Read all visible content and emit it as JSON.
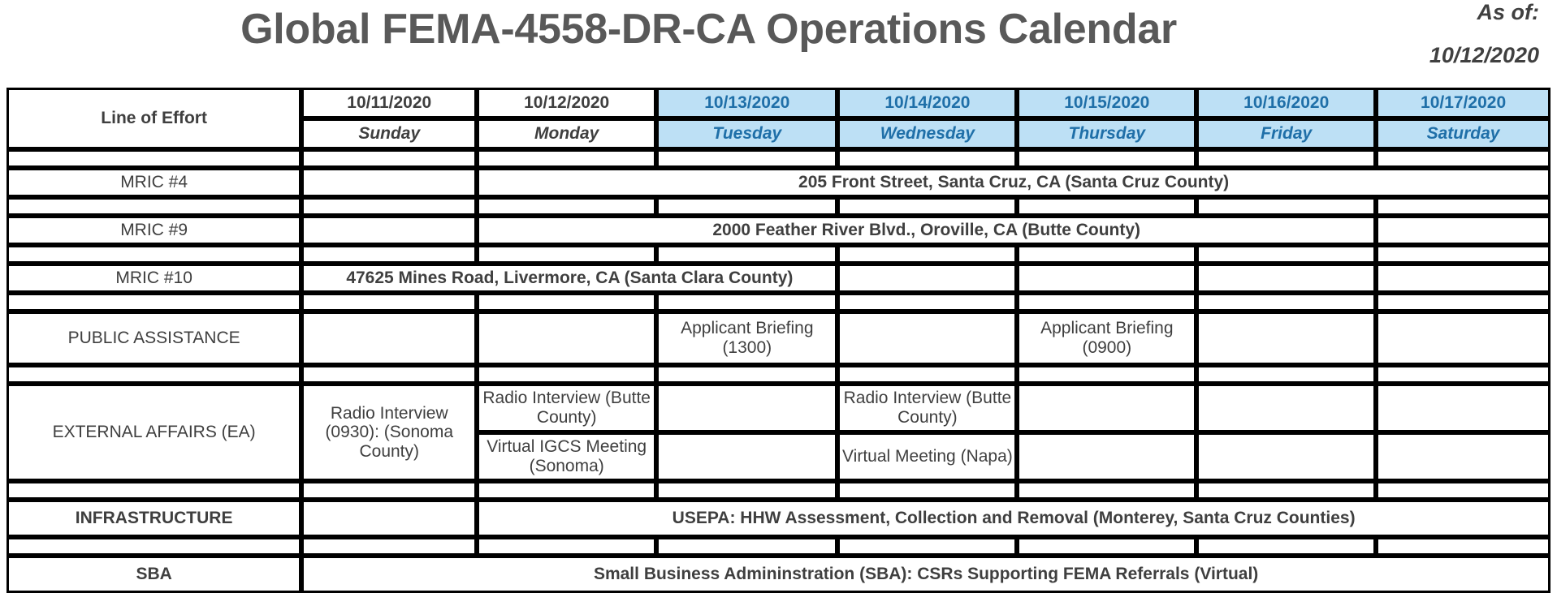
{
  "header": {
    "title": "Global FEMA-4558-DR-CA Operations Calendar",
    "as_of_label": "As of:",
    "as_of_date": "10/12/2020"
  },
  "colors": {
    "weekend_header_bg": "#bde0f5",
    "weekend_header_text": "#1f6fa8",
    "weekday_header_bg": "#f2f2f2",
    "mric4_bg": "#f8e0bc",
    "mric9_bg": "#84c5ea",
    "mric10_bg": "#f4b195",
    "public_assistance_bg": "#17b54a",
    "external_affairs_bg": "#ff66cc",
    "infrastructure_bg": "#ffff00",
    "sba_bg": "#4a5526",
    "title_text": "#595959"
  },
  "table": {
    "corner_label": "Line of Effort",
    "columns": [
      {
        "date": "10/11/2020",
        "day": "Sunday",
        "weekend_style": false
      },
      {
        "date": "10/12/2020",
        "day": "Monday",
        "weekend_style": false
      },
      {
        "date": "10/13/2020",
        "day": "Tuesday",
        "weekend_style": true
      },
      {
        "date": "10/14/2020",
        "day": "Wednesday",
        "weekend_style": true
      },
      {
        "date": "10/15/2020",
        "day": "Thursday",
        "weekend_style": true
      },
      {
        "date": "10/16/2020",
        "day": "Friday",
        "weekend_style": true
      },
      {
        "date": "10/17/2020",
        "day": "Saturday",
        "weekend_style": true
      }
    ],
    "rows": {
      "mric4": {
        "label": "MRIC #4",
        "event": "205 Front Street, Santa Cruz, CA (Santa Cruz County)"
      },
      "mric9": {
        "label": "MRIC #9",
        "event": "2000 Feather River Blvd., Oroville, CA (Butte County)"
      },
      "mric10": {
        "label": "MRIC #10",
        "event": "47625 Mines Road, Livermore, CA (Santa Clara County)"
      },
      "public_assistance": {
        "label": "PUBLIC ASSISTANCE",
        "tuesday": "Applicant Briefing (1300)",
        "thursday": "Applicant Briefing (0900)"
      },
      "external_affairs": {
        "label": "EXTERNAL AFFAIRS (EA)",
        "sunday": "Radio Interview (0930): (Sonoma County)",
        "monday_top": "Radio Interview (Butte County)",
        "monday_bottom": "Virtual IGCS Meeting (Sonoma)",
        "wednesday_top": "Radio Interview (Butte County)",
        "wednesday_bottom": "Virtual Meeting (Napa)"
      },
      "infrastructure": {
        "label": "INFRASTRUCTURE",
        "event": "USEPA: HHW Assessment, Collection and Removal (Monterey, Santa Cruz Counties)"
      },
      "sba": {
        "label": "SBA",
        "event": "Small Business Admininstration (SBA): CSRs Supporting FEMA Referrals (Virtual)"
      }
    }
  }
}
